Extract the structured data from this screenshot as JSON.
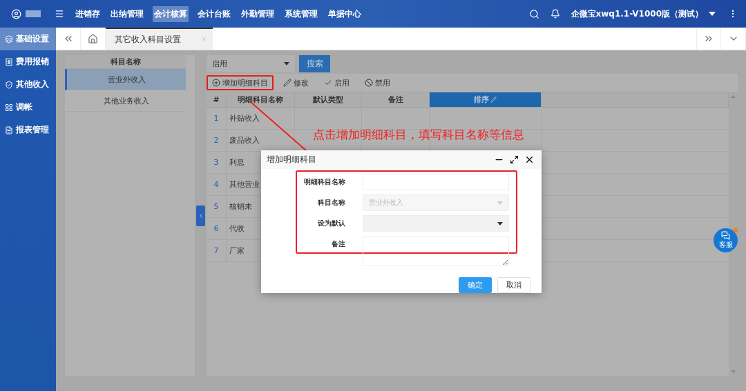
{
  "top_bar": {
    "nav": [
      {
        "label": "进销存",
        "selected": false
      },
      {
        "label": "出纳管理",
        "selected": false
      },
      {
        "label": "会计核算",
        "selected": true
      },
      {
        "label": "会计台账",
        "selected": false
      },
      {
        "label": "外勤管理",
        "selected": false
      },
      {
        "label": "系统管理",
        "selected": false
      },
      {
        "label": "单据中心",
        "selected": false
      }
    ],
    "account": "企微宝xwq1.1-V1000版（测试）"
  },
  "sidebar": {
    "items": [
      {
        "label": "基础设置",
        "selected": true
      },
      {
        "label": "费用报销",
        "selected": false
      },
      {
        "label": "其他收入",
        "selected": false
      },
      {
        "label": "调帐",
        "selected": false
      },
      {
        "label": "报表管理",
        "selected": false
      }
    ]
  },
  "tab_bar": {
    "tabs": [
      {
        "label": "其它收入科目设置",
        "selected": true
      }
    ]
  },
  "subject_panel": {
    "header": "科目名称",
    "items": [
      {
        "label": "营业外收入",
        "selected": true
      },
      {
        "label": "其他业务收入",
        "selected": false
      }
    ]
  },
  "filter": {
    "status": "启用",
    "search_button": "搜索"
  },
  "toolbar": [
    {
      "label": "增加明细科目",
      "highlighted": true
    },
    {
      "label": "修改",
      "highlighted": false
    },
    {
      "label": "启用",
      "highlighted": false
    },
    {
      "label": "禁用",
      "highlighted": false
    }
  ],
  "table": {
    "columns": [
      {
        "label": "#",
        "selected": false
      },
      {
        "label": "明细科目名称",
        "selected": false
      },
      {
        "label": "默认类型",
        "selected": false
      },
      {
        "label": "备注",
        "selected": false
      },
      {
        "label": "排序",
        "selected": true
      }
    ],
    "rows": [
      {
        "index": "1",
        "name": "补贴收入"
      },
      {
        "index": "2",
        "name": "废品收入"
      },
      {
        "index": "3",
        "name": "利息"
      },
      {
        "index": "4",
        "name": "其他营业"
      },
      {
        "index": "5",
        "name": "核销未"
      },
      {
        "index": "6",
        "name": "代收"
      },
      {
        "index": "7",
        "name": "厂家"
      }
    ]
  },
  "annotation": {
    "text": "点击增加明细科目，填写科目名称等信息"
  },
  "dialog": {
    "title": "增加明细科目",
    "fields": [
      {
        "label": "明细科目名称",
        "kind": "input"
      },
      {
        "label": "科目名称",
        "kind": "select",
        "value": "营业外收入",
        "disabled": true
      },
      {
        "label": "设为默认",
        "kind": "select",
        "disabled": false
      },
      {
        "label": "备注",
        "kind": "textarea"
      }
    ],
    "buttons": [
      {
        "label": "确定",
        "primary": true
      },
      {
        "label": "取消",
        "primary": false
      }
    ]
  },
  "chat_button": {
    "label": "客服",
    "unread": true
  }
}
